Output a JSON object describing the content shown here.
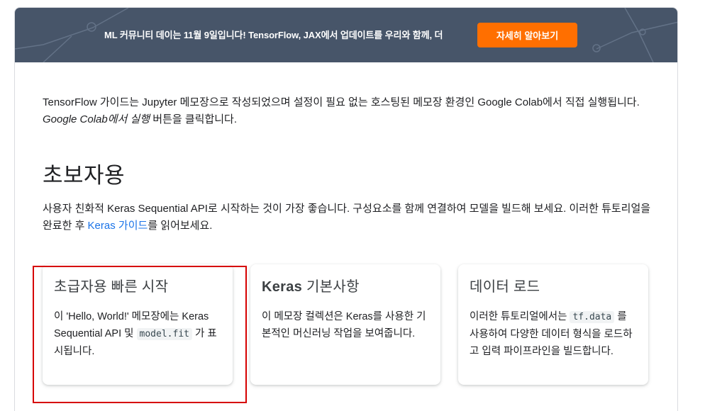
{
  "banner": {
    "text": "ML 커뮤니티 데이는 11월 9일입니다! TensorFlow, JAX에서 업데이트를 우리와 함께, 더",
    "button_label": "자세히 알아보기",
    "background_color": "#475569",
    "button_color": "#ff6f00"
  },
  "intro": {
    "part1": "TensorFlow 가이드는 Jupyter 메모장으로 작성되었으며 설정이 필요 없는 호스팅된 메모장 환경인 Google Colab에서 직접 실행됩니다. ",
    "emphasis": "Google Colab에서 실행",
    "part2": " 버튼을 클릭합니다."
  },
  "section": {
    "title": "초보자용",
    "desc_part1": "사용자 친화적 Keras Sequential API로 시작하는 것이 가장 좋습니다. 구성요소를 함께 연결하여 모델을 빌드해 보세요. 이러한 튜토리얼을 완료한 후 ",
    "link": "Keras 가이드",
    "desc_part2": "를 읽어보세요."
  },
  "cards": [
    {
      "title": "초급자용 빠른 시작",
      "text_before": "이 'Hello, World!' 메모장에는 Keras Sequential API 및 ",
      "code": "model.fit",
      "text_after": " 가 표시됩니다."
    },
    {
      "title_bold": "Keras",
      "title_rest": " 기본사항",
      "text": "이 메모장 컬렉션은 Keras를 사용한 기본적인 머신러닝 작업을 보여줍니다."
    },
    {
      "title": "데이터 로드",
      "text_before": "이러한 튜토리얼에서는 ",
      "code": "tf.data",
      "text_after": " 를 사용하여 다양한 데이터 형식을 로드하고 입력 파이프라인을 빌드합니다."
    }
  ],
  "highlight_color": "#d60000",
  "link_color": "#1a73e8"
}
